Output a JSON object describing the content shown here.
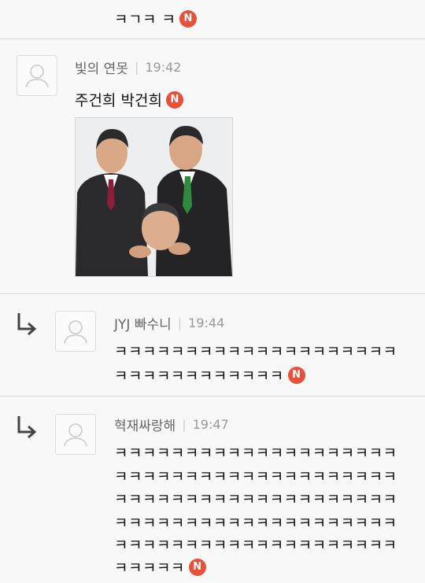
{
  "comments": [
    {
      "text": "ㅋㄱㅋ ㅋ",
      "badge": "N"
    },
    {
      "author": "빛의 연못",
      "time": "19:42",
      "text": "주건희 박건희",
      "badge": "N"
    },
    {
      "author": "JYJ 빠수니",
      "time": "19:44",
      "lines": [
        "ㅋㅋㅋㅋㅋㅋㅋㅋㅋㅋㅋㅋㅋㅋㅋㅋㅋㅋㅋㅋ",
        "ㅋㅋㅋㅋㅋㅋㅋㅋㅋㅋㅋㅋ"
      ],
      "badge": "N"
    },
    {
      "author": "혁재싸랑해",
      "time": "19:47",
      "lines": [
        "ㅋㅋㅋㅋㅋㅋㅋㅋㅋㅋㅋㅋㅋㅋㅋㅋㅋㅋㅋㅋ",
        "ㅋㅋㅋㅋㅋㅋㅋㅋㅋㅋㅋㅋㅋㅋㅋㅋㅋㅋㅋㅋ",
        "ㅋㅋㅋㅋㅋㅋㅋㅋㅋㅋㅋㅋㅋㅋㅋㅋㅋㅋㅋㅋ",
        "ㅋㅋㅋㅋㅋㅋㅋㅋㅋㅋㅋㅋㅋㅋㅋㅋㅋㅋㅋㅋ",
        "ㅋㅋㅋㅋㅋㅋㅋㅋㅋㅋㅋㅋㅋㅋㅋㅋㅋㅋㅋㅋ",
        "ㅋㅋㅋㅋㅋ"
      ],
      "badge": "N"
    }
  ],
  "colors": {
    "badge": "#e8503a",
    "divider": "#d9d9d9",
    "time": "#999999"
  },
  "icons": {
    "avatar": "default-user-icon",
    "reply": "reply-arrow-icon"
  }
}
